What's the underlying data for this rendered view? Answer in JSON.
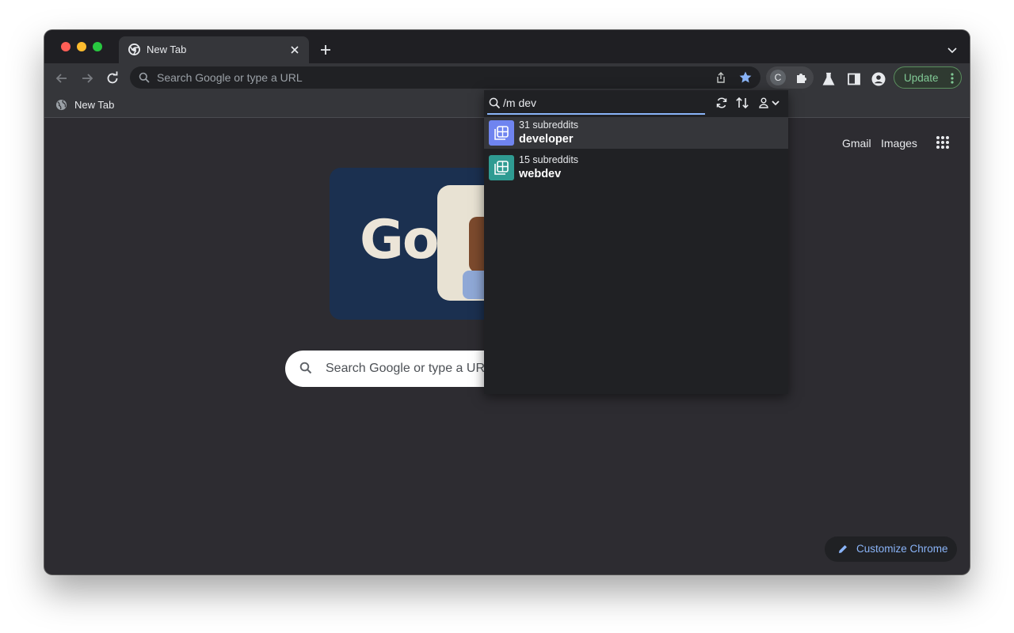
{
  "tab": {
    "title": "New Tab"
  },
  "omnibox": {
    "placeholder": "Search Google or type a URL"
  },
  "extensions": {
    "c_label": "C"
  },
  "toolbar": {
    "update_label": "Update"
  },
  "bookmarks": {
    "items": [
      {
        "label": "New Tab"
      }
    ]
  },
  "ntp": {
    "links": {
      "gmail": "Gmail",
      "images": "Images"
    },
    "search_placeholder": "Search Google or type a URL",
    "doodle_text": "Go",
    "customize_label": "Customize Chrome"
  },
  "popup": {
    "query": "/m dev",
    "results": [
      {
        "subtitle": "31 subreddits",
        "name": "developer",
        "color": "#6f84f0"
      },
      {
        "subtitle": "15 subreddits",
        "name": "webdev",
        "color": "#2f9b92"
      }
    ]
  },
  "colors": {
    "accent": "#8ab4f8",
    "update_green": "#81c995",
    "traffic_close": "#fe5f57",
    "traffic_min": "#febc2e",
    "traffic_max": "#28c840"
  }
}
